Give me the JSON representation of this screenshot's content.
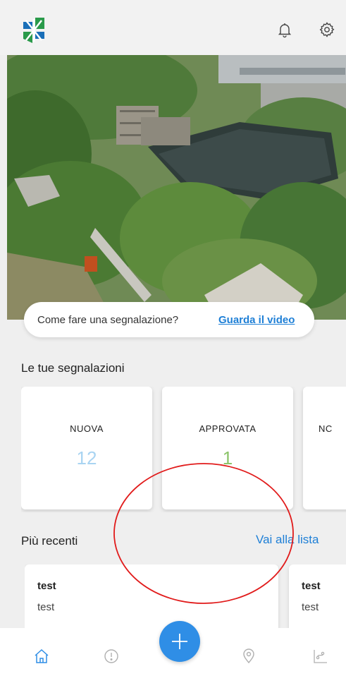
{
  "header": {
    "logo_icon": "app-logo-icon",
    "bell_icon": "bell-icon",
    "settings_icon": "gear-icon"
  },
  "banner": {
    "question": "Come fare una segnalazione?",
    "video_link": "Guarda il video"
  },
  "reports": {
    "title": "Le tue segnalazioni",
    "cards": [
      {
        "label": "NUOVA",
        "count": "12",
        "color": "#a9d4f2"
      },
      {
        "label": "APPROVATA",
        "count": "1",
        "color": "#8cc46a"
      },
      {
        "label": "NC",
        "count": ""
      }
    ]
  },
  "recent": {
    "title": "Più recenti",
    "link": "Vai alla lista",
    "items": [
      {
        "title": "test",
        "subtitle": "test"
      },
      {
        "title": "test",
        "subtitle": "test"
      }
    ]
  },
  "colors": {
    "accent": "#1e7fd6",
    "fab": "#2f8ee6",
    "annotation": "#e11b1b"
  }
}
